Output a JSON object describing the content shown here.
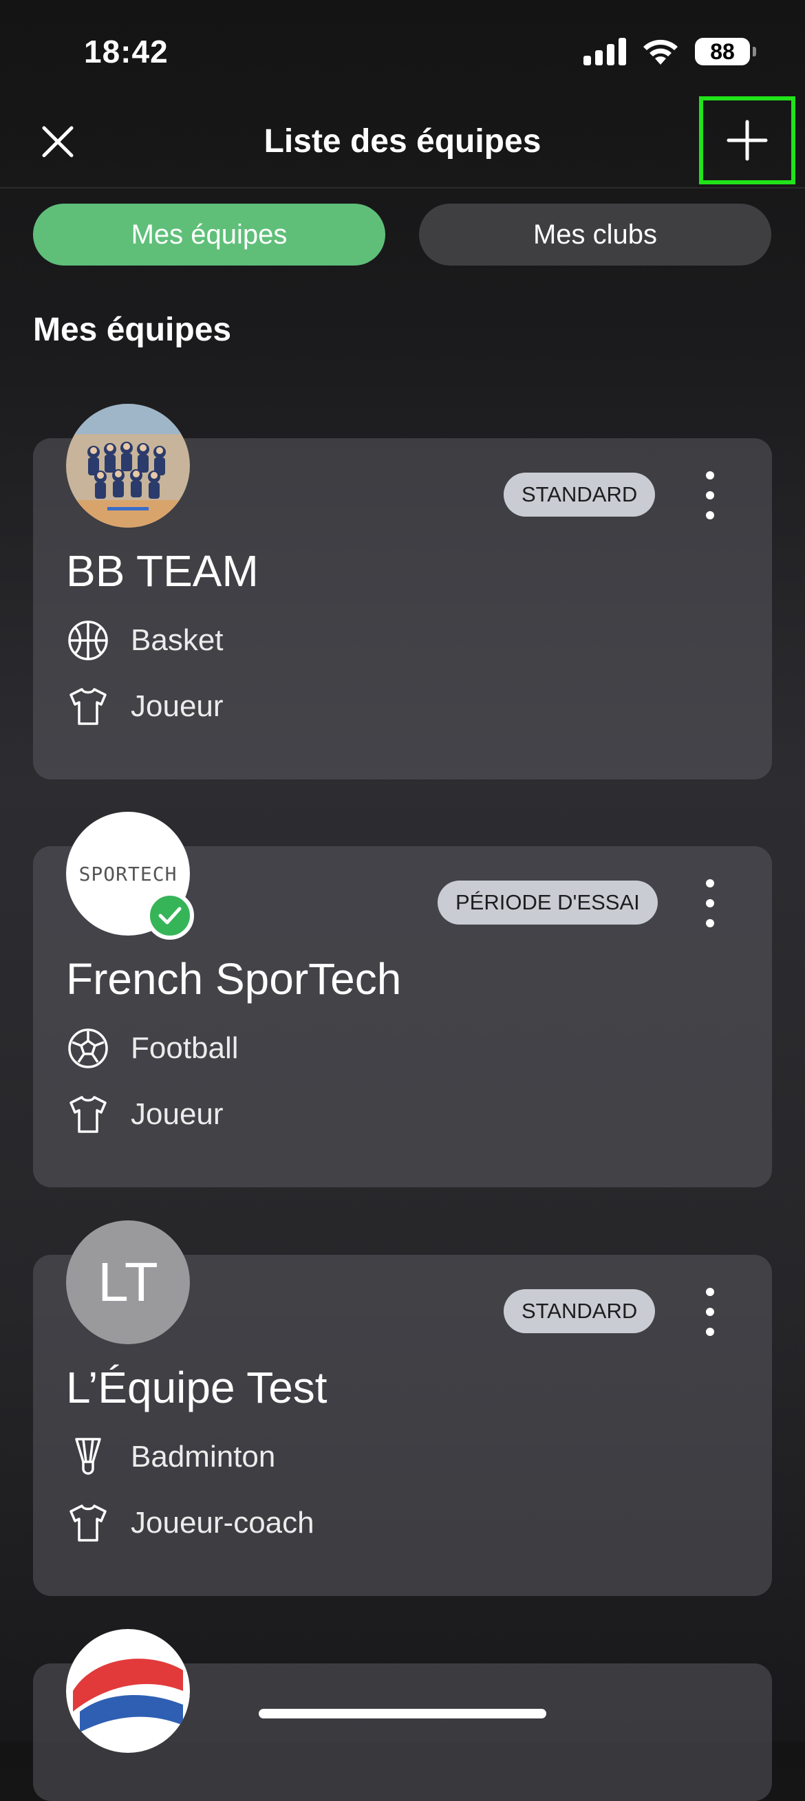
{
  "status_bar": {
    "time": "18:42",
    "battery": "88"
  },
  "header": {
    "title": "Liste des équipes",
    "close_icon": "close-icon",
    "add_icon": "plus-icon"
  },
  "tabs": [
    {
      "label": "Mes équipes",
      "active": true
    },
    {
      "label": "Mes clubs",
      "active": false
    }
  ],
  "section_title": "Mes équipes",
  "teams": [
    {
      "name": "BB TEAM",
      "badge": "STANDARD",
      "sport": "Basket",
      "sport_icon": "basketball-icon",
      "role": "Joueur",
      "role_icon": "jersey-icon",
      "avatar": "team-photo"
    },
    {
      "name": "French SporTech",
      "badge": "PÉRIODE D'ESSAI",
      "sport": "Football",
      "sport_icon": "soccer-ball-icon",
      "role": "Joueur",
      "role_icon": "jersey-icon",
      "avatar_text": "SPORTECH",
      "verified": true
    },
    {
      "name": "L’Équipe Test",
      "badge": "STANDARD",
      "sport": "Badminton",
      "sport_icon": "shuttlecock-icon",
      "role": "Joueur-coach",
      "role_icon": "jersey-icon",
      "avatar_text": "LT"
    }
  ],
  "colors": {
    "accent": "#5fbf79",
    "badge_bg": "#c9ccd3",
    "highlight": "#22e31a"
  }
}
